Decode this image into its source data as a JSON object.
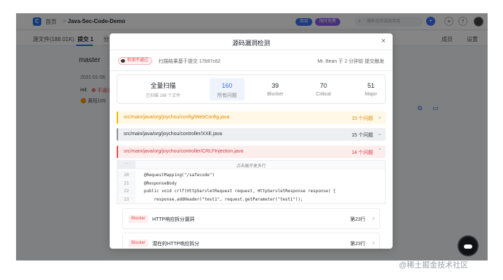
{
  "topbar": {
    "breadcrumb_home": "首页",
    "breadcrumb_sep": ">",
    "repo_name": "Java-Sec-Code-Demo",
    "pill_a": "商城",
    "pill_b": "限时免费",
    "search_placeholder": "搜索仓库或按项目",
    "plus": "+",
    "msg": "≡",
    "help": "?"
  },
  "subbar": {
    "source_files": "源文件(188.01K)",
    "commits": "提交 1",
    "third": "分",
    "members": "成员",
    "settings": "设置"
  },
  "background": {
    "branch": "master",
    "commit_date": "2021-01-06",
    "commit_msg": "init",
    "commit_tag": "❸ 不通过",
    "commit_author": "🟠 黄阳105"
  },
  "modal": {
    "title": "源码漏洞检测",
    "close": "×",
    "status_badge": "检测不通过",
    "scan_info": "扫描结果基于提交 17b97c82",
    "commit_info": "Mr. Bean 于 2 分钟前 提交触发",
    "stats": {
      "main_title": "全量扫描",
      "main_sub": "已扫描 188 个文件",
      "items": [
        {
          "value": "160",
          "label": "所有问题"
        },
        {
          "value": "39",
          "label": "Blocker"
        },
        {
          "value": "70",
          "label": "Critical"
        },
        {
          "value": "51",
          "label": "Major"
        }
      ]
    },
    "files": [
      {
        "path": "src/main/java/org/joychou/config/WebConfig.java",
        "count": "15 个问题"
      },
      {
        "path": "src/main/java/org/joychou/controller/XXE.java",
        "count": "15 个问题"
      },
      {
        "path": "src/main/java/org/joychou/controller/CRLFInjection.java",
        "count": "14 个问题"
      }
    ],
    "code": {
      "expand_dots": "···",
      "expand_text": "点击展开更多行",
      "lines": [
        {
          "no": "20",
          "src": "@RequestMapping(\"/safecode\")"
        },
        {
          "no": "21",
          "src": "@ResponseBody"
        },
        {
          "no": "22",
          "src": "public void crlf(HttpServletRequest request, HttpServletResponse response) {"
        },
        {
          "no": "23",
          "src": "    response.addHeader(\"test1\", request.getParameter(\"test1\"));"
        }
      ]
    },
    "issues": [
      {
        "severity": "Blocker",
        "title": "HTTP响应拆分漏洞",
        "line": "第23行"
      },
      {
        "severity": "Blocker",
        "title": "潜在的HTTP响应拆分",
        "line": "第23行"
      }
    ]
  },
  "watermark": "@稀土掘金技术社区",
  "colors": {
    "accent": "#1f6fe5",
    "danger": "#e5484d",
    "warning": "#e08a00"
  }
}
